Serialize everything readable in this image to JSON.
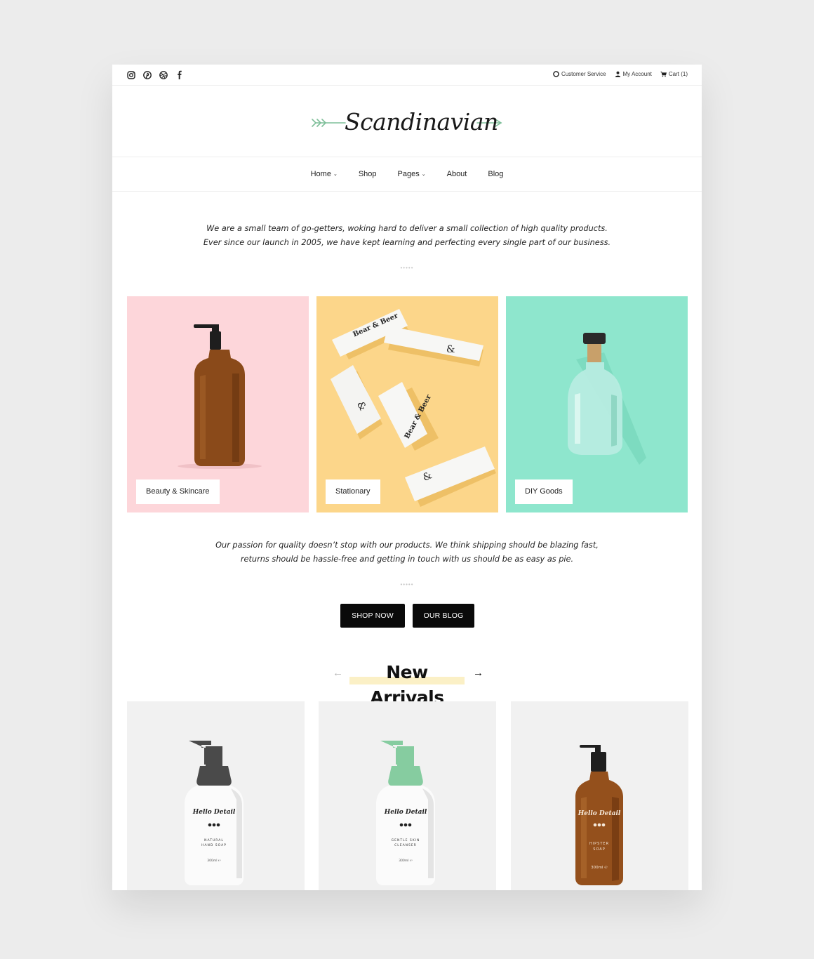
{
  "topbar": {
    "social": [
      "instagram-icon",
      "pinterest-icon",
      "dribbble-icon",
      "facebook-icon"
    ],
    "customer_service": "Customer Service",
    "my_account": "My Account",
    "cart": "Cart (1)"
  },
  "logo": {
    "text": "Scandinavian",
    "accent": "#7fbf9a"
  },
  "nav": {
    "home": "Home",
    "shop": "Shop",
    "pages": "Pages",
    "about": "About",
    "blog": "Blog"
  },
  "intro": {
    "line1": "We are a small team of go-getters, woking hard to deliver a small collection of high quality products.",
    "line2": "Ever since our launch in 2005, we have kept learning and perfecting every single part of our business."
  },
  "categories": [
    {
      "label": "Beauty & Skincare",
      "bg": "#fdd6da"
    },
    {
      "label": "Stationary",
      "bg": "#fcd68a"
    },
    {
      "label": "DIY Goods",
      "bg": "#8ee6cd"
    }
  ],
  "stationery_print": {
    "brand": "Bear & Beer",
    "mark": "&"
  },
  "passion": {
    "line1": "Our passion for quality doesn’t stop with our products. We think shipping should be blazing fast,",
    "line2": "returns should be hassle-free and getting in touch with us should be as easy as pie."
  },
  "buttons": {
    "shop_now": "SHOP NOW",
    "our_blog": "OUR BLOG"
  },
  "arrivals": {
    "title": "New Arrivals",
    "prev": "←",
    "next": "→"
  },
  "products": [
    {
      "brand": "Hello Detail",
      "name_line1": "NATURAL",
      "name_line2": "HAND SOAP",
      "volume": "300ml ℮",
      "pump_color": "#4a4a4a"
    },
    {
      "brand": "Hello Detail",
      "name_line1": "GENTLE SKIN",
      "name_line2": "CLEANSER",
      "volume": "300ml ℮",
      "pump_color": "#86cca0"
    },
    {
      "brand": "Hello Detail",
      "name_line1": "HIPSTER",
      "name_line2": "SOAP",
      "volume": "300ml ℮",
      "pump_color": "#1f1f1f"
    }
  ]
}
